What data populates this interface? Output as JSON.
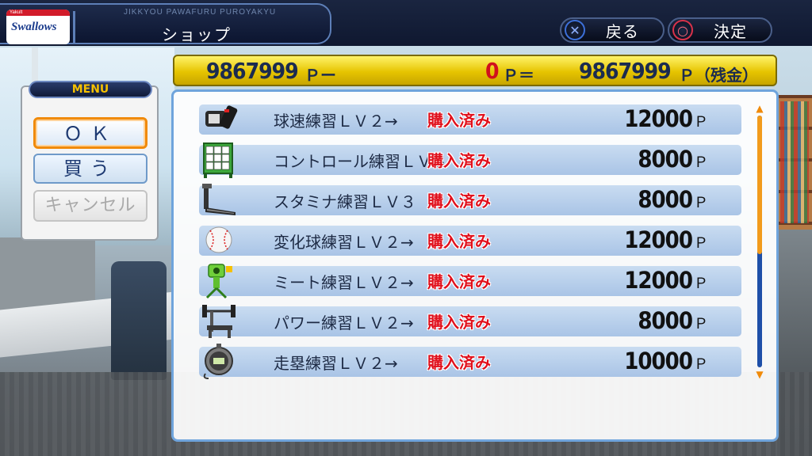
{
  "header": {
    "logo": {
      "brand_small": "Yakult",
      "brand": "Swallows"
    },
    "subtitle": "JIKKYOU PAWAFURU PUROYAKYU",
    "title": "ショップ",
    "back_button": {
      "label": "戻る",
      "glyph": "✕"
    },
    "confirm_button": {
      "label": "決定",
      "glyph": "○"
    }
  },
  "points": {
    "current": "9867999",
    "current_suffix": "Ｐー",
    "cost": "0",
    "cost_suffix": "Ｐ＝",
    "remaining": "9867999",
    "remaining_suffix": "Ｐ（残金）"
  },
  "menu": {
    "title": "MENU",
    "items": [
      {
        "label": "ＯＫ"
      },
      {
        "label": "買う"
      },
      {
        "label": "キャンセル"
      }
    ]
  },
  "shop": {
    "items": [
      {
        "name": "球速練習ＬＶ２→",
        "sold": "購入済み",
        "price": "12000",
        "unit": "Ｐ",
        "icon": "speed-gun-icon"
      },
      {
        "name": "コントロール練習ＬＶ３",
        "sold": "購入済み",
        "price": "8000",
        "unit": "Ｐ",
        "icon": "target-board-icon"
      },
      {
        "name": "スタミナ練習ＬＶ３",
        "sold": "購入済み",
        "price": "8000",
        "unit": "Ｐ",
        "icon": "treadmill-icon"
      },
      {
        "name": "変化球練習ＬＶ２→",
        "sold": "購入済み",
        "price": "12000",
        "unit": "Ｐ",
        "icon": "baseball-icon"
      },
      {
        "name": "ミート練習ＬＶ２→",
        "sold": "購入済み",
        "price": "12000",
        "unit": "Ｐ",
        "icon": "pitching-machine-icon"
      },
      {
        "name": "パワー練習ＬＶ２→",
        "sold": "購入済み",
        "price": "8000",
        "unit": "Ｐ",
        "icon": "bench-press-icon"
      },
      {
        "name": "走塁練習ＬＶ２→",
        "sold": "購入済み",
        "price": "10000",
        "unit": "Ｐ",
        "icon": "stopwatch-icon"
      }
    ],
    "scroll_position": 0.55
  },
  "colors": {
    "accent": "#f08a0a",
    "sold": "#e0101c",
    "points_bar": "#e6c400",
    "panel_border": "#6fa4dc"
  }
}
